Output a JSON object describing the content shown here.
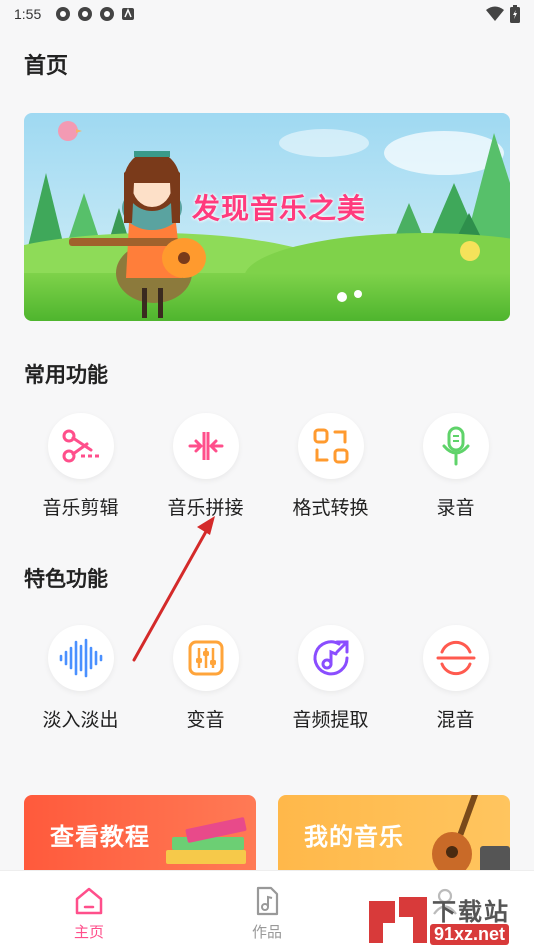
{
  "status_bar": {
    "time": "1:55"
  },
  "page_title": "首页",
  "banner": {
    "headline": "发现音乐之美"
  },
  "sections": {
    "common": {
      "title": "常用功能",
      "tools": [
        {
          "label": "音乐剪辑",
          "icon": "scissors-icon",
          "color": "#ff4f8b"
        },
        {
          "label": "音乐拼接",
          "icon": "merge-icon",
          "color": "#ff4f8b"
        },
        {
          "label": "格式转换",
          "icon": "convert-icon",
          "color": "#ff9a2e"
        },
        {
          "label": "录音",
          "icon": "microphone-icon",
          "color": "#5fd36a"
        }
      ]
    },
    "featured": {
      "title": "特色功能",
      "tools": [
        {
          "label": "淡入淡出",
          "icon": "waveform-icon",
          "color": "#4a90ff"
        },
        {
          "label": "变音",
          "icon": "equalizer-icon",
          "color": "#ffa43a"
        },
        {
          "label": "音频提取",
          "icon": "music-extract-icon",
          "color": "#8a4dff"
        },
        {
          "label": "混音",
          "icon": "mix-icon",
          "color": "#ff5a4f"
        }
      ]
    }
  },
  "cards": [
    {
      "label": "查看教程",
      "color": "#ff5a3c"
    },
    {
      "label": "我的音乐",
      "color": "#ffb84a"
    }
  ],
  "bottom_nav": [
    {
      "label": "主页",
      "active": true
    },
    {
      "label": "作品",
      "active": false
    },
    {
      "label": "",
      "active": false
    }
  ],
  "watermark": {
    "text": "下载站",
    "url": "91xz.net"
  },
  "colors": {
    "accent": "#ff4f8b",
    "background": "#f7f7f8"
  }
}
